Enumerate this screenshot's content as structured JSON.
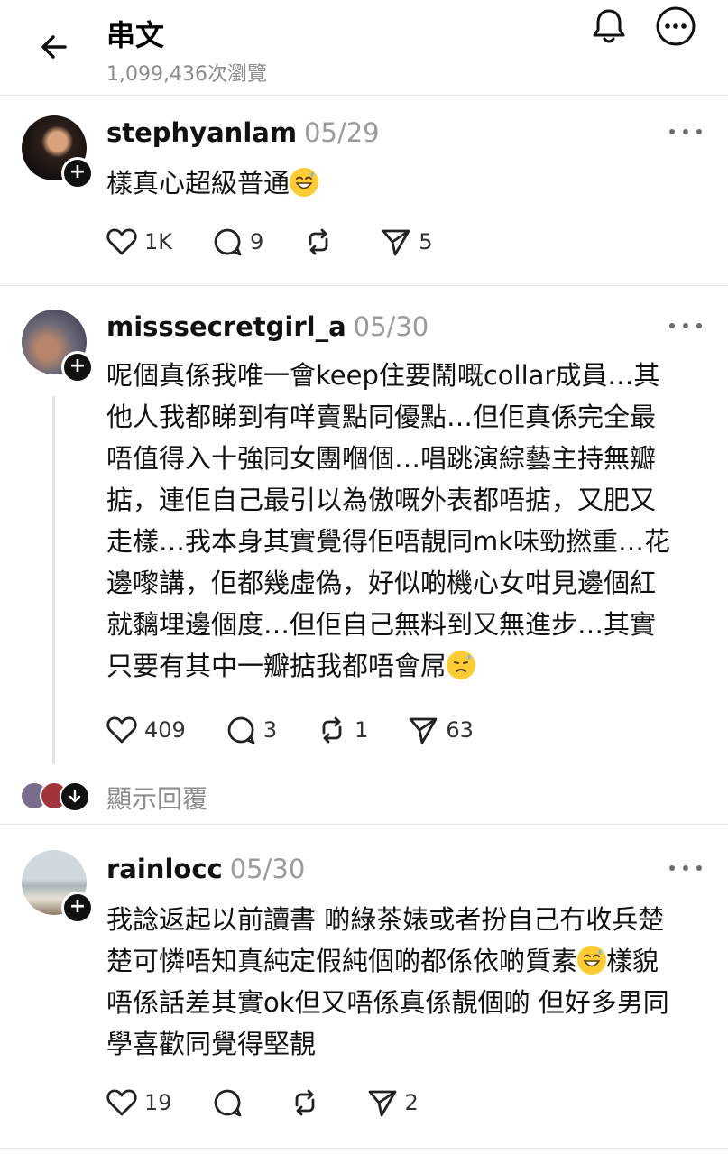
{
  "header": {
    "title": "串文",
    "views": "1,099,436次瀏覽"
  },
  "posts": [
    {
      "username": "stephyanlam",
      "date": "05/29",
      "text": "樣真心超級普通",
      "emoji": "grin-sweat-emoji",
      "likes": "1K",
      "comments": "9",
      "reposts": "",
      "shares": "5"
    },
    {
      "username": "misssecretgirl_a",
      "date": "05/30",
      "text": "呢個真係我唯一會keep住要鬧嘅collar成員…其\n他人我都睇到有咩賣點同優點…但佢真係完全最\n唔值得入十強同女團嗰個…唱跳演綜藝主持無瓣\n掂，連佢自己最引以為傲嘅外表都唔掂，又肥又\n走樣…我本身其實覺得佢唔靚同mk味勁撚重…花\n邊嚟講，佢都幾虛偽，好似啲機心女咁見邊個紅\n就黐埋邊個度…但佢自己無料到又無進步…其實\n只要有其中一瓣掂我都唔會屌",
      "emoji": "sad-sweat-emoji",
      "likes": "409",
      "comments": "3",
      "reposts": "1",
      "shares": "63"
    },
    {
      "username": "rainlocc",
      "date": "05/30",
      "text_part1": "我諗返起以前讀書 啲綠茶婊或者扮自己冇收兵楚\n楚可憐唔知真純定假純個啲都係依啲質素",
      "text_part2": "樣貌\n唔係話差其實ok但又唔係真係靚個啲 但好多男同\n學喜歡同覺得堅靚",
      "emoji": "grin-sweat-emoji",
      "likes": "19",
      "comments": "",
      "reposts": "",
      "shares": "2"
    }
  ],
  "show_replies": "顯示回覆",
  "colors": {
    "muted": "#8c8c8c",
    "text": "#111111",
    "divider": "#e6e6e6",
    "emoji": "#ffcc33"
  }
}
